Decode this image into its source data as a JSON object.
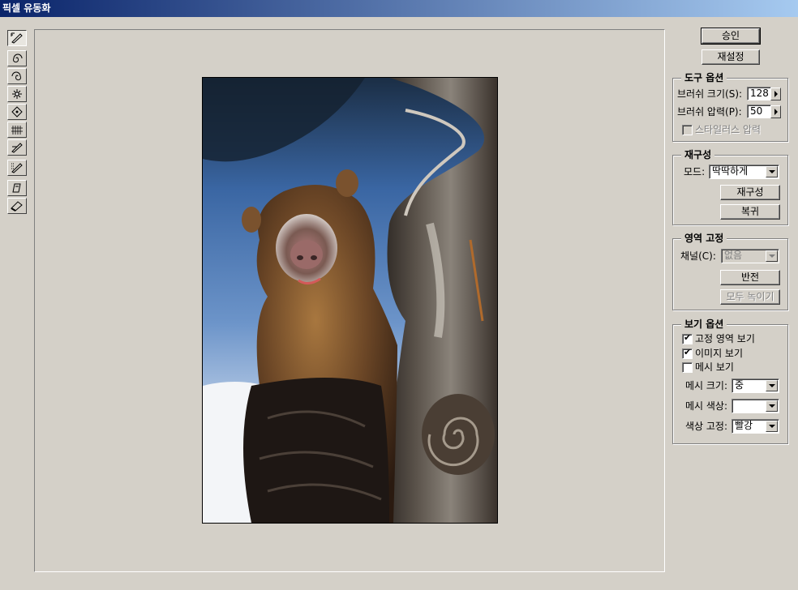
{
  "window": {
    "title": "픽셀 유동화"
  },
  "tools": [
    {
      "name": "warp-tool-icon",
      "active": true
    },
    {
      "name": "twirl-clockwise-tool-icon"
    },
    {
      "name": "twirl-counterclockwise-tool-icon"
    },
    {
      "name": "pucker-tool-icon"
    },
    {
      "name": "bloat-tool-icon"
    },
    {
      "name": "shift-pixels-tool-icon"
    },
    {
      "name": "reflection-tool-icon"
    },
    {
      "name": "reconstruct-tool-icon"
    },
    {
      "name": "freeze-tool-icon"
    },
    {
      "name": "thaw-tool-icon"
    }
  ],
  "buttons": {
    "ok": "승인",
    "reset": "재설정"
  },
  "tool_options": {
    "legend": "도구 옵션",
    "brush_size_label": "브러쉬 크기(S):",
    "brush_size": "128",
    "brush_pressure_label": "브러쉬 압력(P):",
    "brush_pressure": "50",
    "stylus_label": "스타일러스 압력"
  },
  "reconstruction": {
    "legend": "재구성",
    "mode_label": "모드:",
    "mode": "딱딱하게",
    "reconstruct_button": "재구성",
    "revert_button": "복귀"
  },
  "freeze_area": {
    "legend": "영역 고정",
    "channel_label": "채널(C):",
    "channel": "없음",
    "invert_button": "반전",
    "thaw_all_button": "모두 녹이기"
  },
  "view_options": {
    "legend": "보기 옵션",
    "show_frozen": "고정 영역 보기",
    "show_image": "이미지 보기",
    "show_mesh": "메시 보기",
    "mesh_size_label": "메시 크기:",
    "mesh_size": "중",
    "mesh_color_label": "메시 색상:",
    "mesh_color": "",
    "freeze_color_label": "색상 고정:",
    "freeze_color": "빨강"
  }
}
